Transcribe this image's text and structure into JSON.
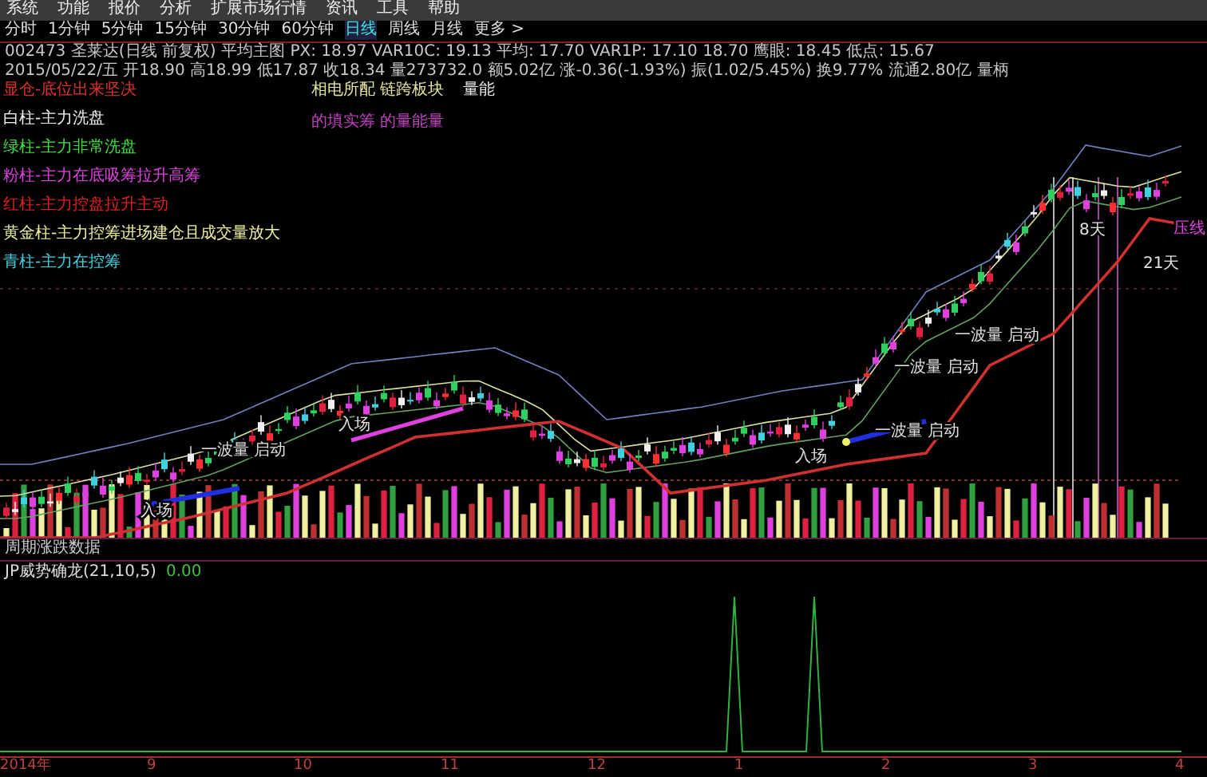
{
  "menu": [
    "系统",
    "功能",
    "报价",
    "分析",
    "扩展市场行情",
    "资讯",
    "工具",
    "帮助"
  ],
  "periods": [
    {
      "label": "分时",
      "selected": false
    },
    {
      "label": "1分钟",
      "selected": false
    },
    {
      "label": "5分钟",
      "selected": false
    },
    {
      "label": "15分钟",
      "selected": false
    },
    {
      "label": "30分钟",
      "selected": false
    },
    {
      "label": "60分钟",
      "selected": false
    },
    {
      "label": "日线",
      "selected": true
    },
    {
      "label": "周线",
      "selected": false
    },
    {
      "label": "月线",
      "selected": false
    },
    {
      "label": "更多 >",
      "selected": false
    }
  ],
  "info_lines": [
    "002473 圣莱达(日线 前复权) 平均主图 PX: 18.97 VAR10C: 19.13 平均: 17.70 VAR1P: 17.10 18.70 鹰眼: 18.45 低点: 15.67",
    "2015/05/22/五 开18.90 高18.99 低17.87 收18.34 量273732.0 额5.02亿 涨-0.36(-1.93%) 振(1.02/5.45%) 换9.77% 流通2.80亿 量柄"
  ],
  "center_notes": [
    {
      "text": "相电所配 链跨板块",
      "color": "#e8e8a0"
    },
    {
      "text": "量能",
      "color": "#e8e8e8"
    }
  ],
  "sub_note": "的填实筹 的量能量",
  "legend": [
    {
      "text": "显仓-底位出来坚决",
      "color": "#e03030"
    },
    {
      "text": "白柱-主力洗盘",
      "color": "#f0f0f0"
    },
    {
      "text": "绿柱-主力非常洗盘",
      "color": "#40e040"
    },
    {
      "text": "粉柱-主力在底吸筹拉升高筹",
      "color": "#e040e0"
    },
    {
      "text": "红柱-主力控盘拉升主动",
      "color": "#e02020"
    },
    {
      "text": "黄金柱-主力控筹进场建仓且成交量放大",
      "color": "#f0f0a0"
    },
    {
      "text": "青柱-主力在控筹",
      "color": "#40d0e0"
    }
  ],
  "chart_annotations": [
    "入场",
    "一波量 启动",
    "入场",
    "入场",
    "一波量 启动",
    "一波量 启动",
    "一波量 启动",
    "8天",
    "21天",
    "压线"
  ],
  "volume_title": "周期涨跌数据",
  "indicator": {
    "title": "JP威势确龙(21,10,5)",
    "value": "0.00"
  },
  "x_axis": [
    "2014年",
    "9",
    "10",
    "11",
    "12",
    "1",
    "2",
    "3",
    "4"
  ]
}
